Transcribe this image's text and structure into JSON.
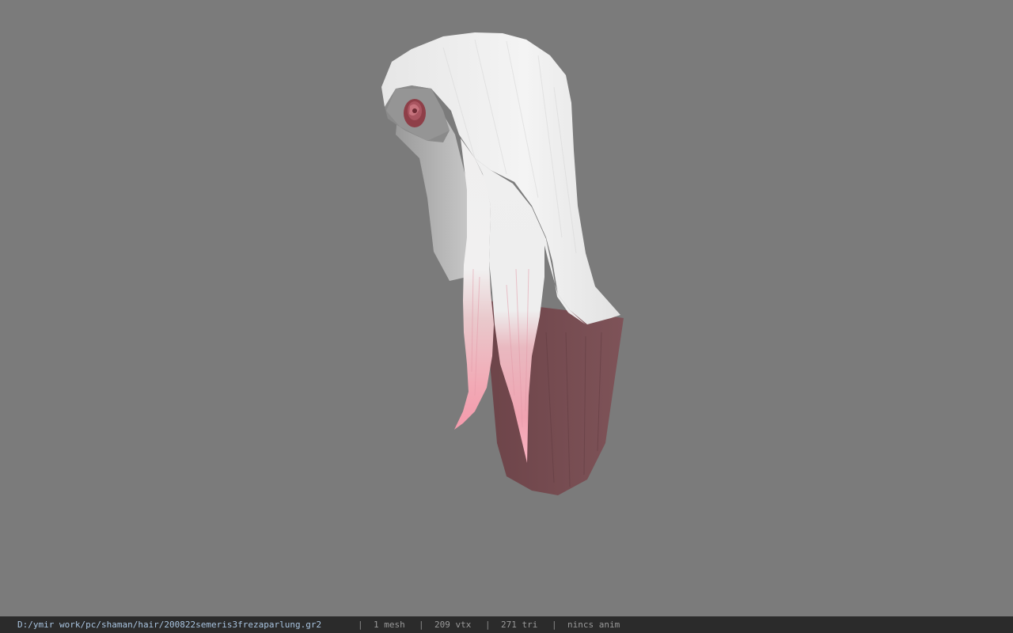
{
  "viewer": {
    "background_color": "#7b7b7b",
    "model_icon": "hair-mesh-3d-model"
  },
  "status_bar": {
    "file_path": "D:/ymir work/pc/shaman/hair/200822semeris3frezaparlung.gr2",
    "separator": "|",
    "mesh_count": "1 mesh",
    "vertex_count": "209 vtx",
    "triangle_count": "271 tri",
    "animation": "nincs anim"
  }
}
